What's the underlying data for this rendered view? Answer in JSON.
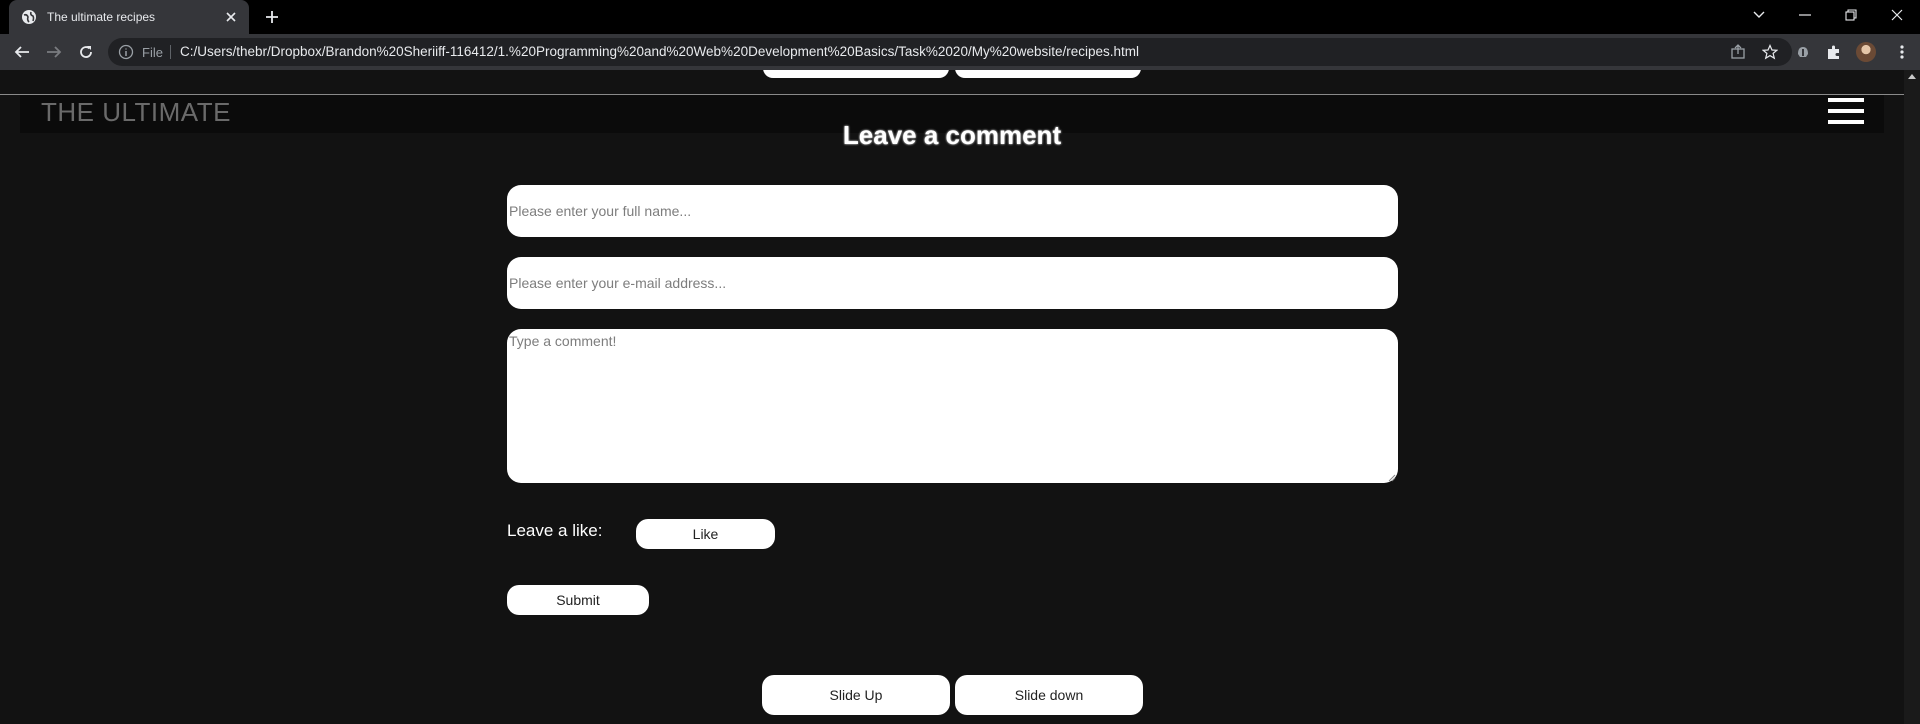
{
  "browser": {
    "tab": {
      "title": "The ultimate recipes",
      "favicon": "globe-icon"
    },
    "address": {
      "scheme_label": "File",
      "url": "C:/Users/thebr/Dropbox/Brandon%20Sheriiff-116412/1.%20Programming%20and%20Web%20Development%20Basics/Task%2020/My%20website/recipes.html"
    },
    "icons": [
      "back-icon",
      "forward-icon",
      "reload-icon",
      "info-icon",
      "share-icon",
      "star-icon",
      "extension-icon",
      "puzzle-icon",
      "profile-avatar",
      "menu-icon"
    ]
  },
  "site": {
    "logo": "THE ULTIMATE"
  },
  "comment_form": {
    "title": "Leave a comment",
    "name_placeholder": "Please enter your full name...",
    "email_placeholder": "Please enter your e-mail address...",
    "comment_placeholder": "Type a comment!",
    "like_label": "Leave a like:",
    "like_button": "Like",
    "submit_button": "Submit"
  },
  "slide_controls": {
    "slide_up": "Slide Up",
    "slide_down": "Slide down"
  },
  "colors": {
    "page_background": "#121212",
    "button_background": "#ffffff",
    "text": "#ffffff"
  }
}
